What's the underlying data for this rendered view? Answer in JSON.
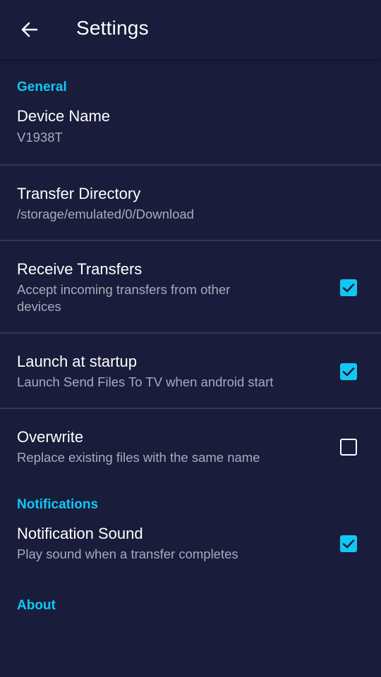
{
  "appbar": {
    "back_icon": "arrow-left-icon",
    "title": "Settings"
  },
  "colors": {
    "background": "#1a1c3b",
    "accent": "#10c8f2",
    "divider": "#33365a",
    "subtitle": "#a9aabd"
  },
  "sections": {
    "general": {
      "header": "General",
      "device_name": {
        "title": "Device Name",
        "value": "V1938T"
      },
      "transfer_directory": {
        "title": "Transfer Directory",
        "value": "/storage/emulated/0/Download"
      },
      "receive_transfers": {
        "title": "Receive Transfers",
        "summary": "Accept incoming transfers from other devices",
        "checked": true
      },
      "launch_at_startup": {
        "title": "Launch at startup",
        "summary": "Launch Send Files To TV when android start",
        "checked": true
      },
      "overwrite": {
        "title": "Overwrite",
        "summary": "Replace existing files with the same name",
        "checked": false
      }
    },
    "notifications": {
      "header": "Notifications",
      "notification_sound": {
        "title": "Notification Sound",
        "summary": "Play sound when a transfer completes",
        "checked": true
      }
    },
    "about": {
      "header": "About"
    }
  }
}
